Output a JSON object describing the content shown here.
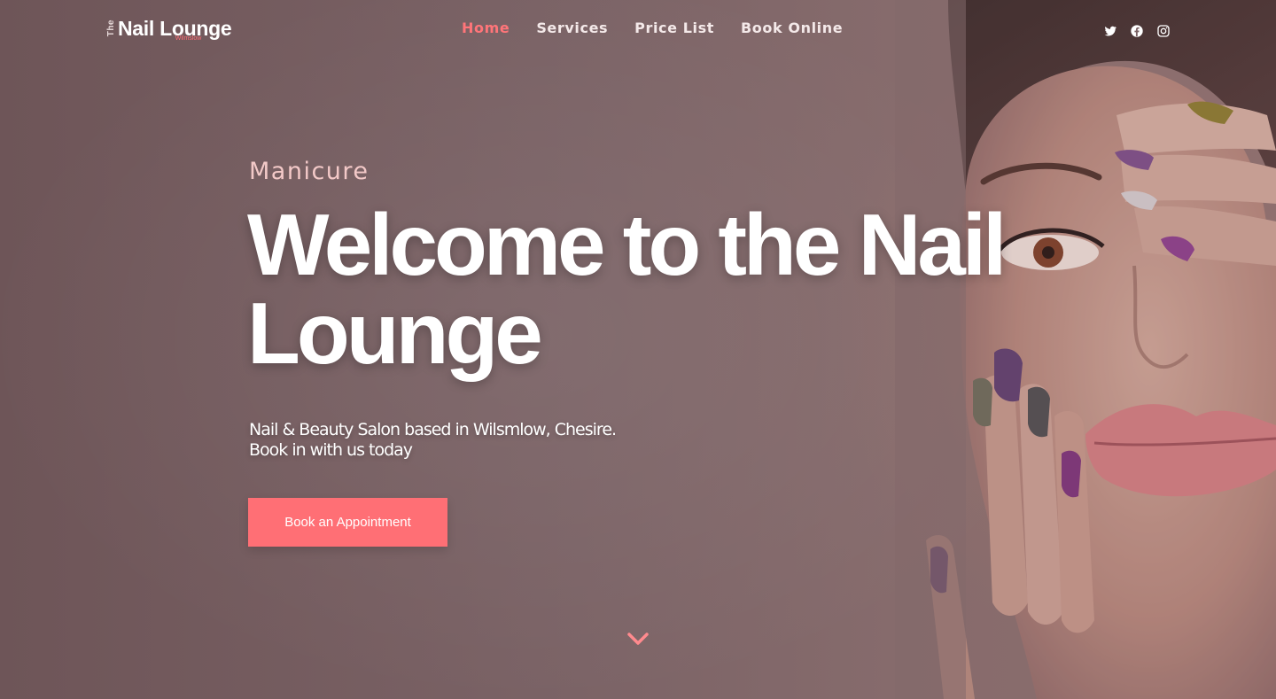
{
  "logo": {
    "prefix": "The",
    "title": "Nail Lounge",
    "subtitle": "Wilmslow"
  },
  "nav": {
    "items": [
      {
        "label": "Home",
        "active": true
      },
      {
        "label": "Services"
      },
      {
        "label": "Price List"
      },
      {
        "label": "Book Online"
      }
    ]
  },
  "social": {
    "icons": [
      "twitter-icon",
      "facebook-icon",
      "instagram-icon"
    ]
  },
  "hero": {
    "eyebrow": "Manicure",
    "headline": "Welcome to the Nail Lounge",
    "subtitle_line1": "Nail & Beauty Salon based in Wilsmlow, Chesire.",
    "subtitle_line2": "Book in with us today",
    "cta_label": "Book an Appointment"
  },
  "colors": {
    "accent": "#ff6f75",
    "nav_active": "#ff7579",
    "eyebrow": "#f3c9c8",
    "overlay": "#7a6164"
  }
}
